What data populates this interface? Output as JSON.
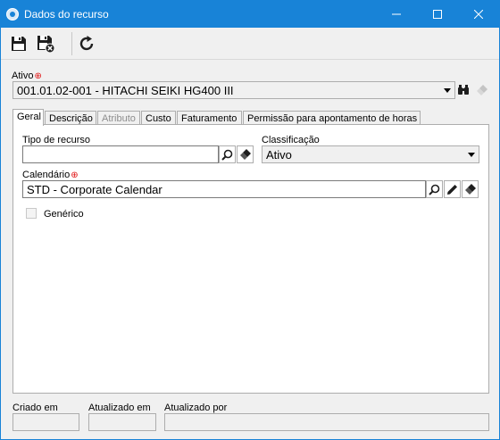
{
  "window": {
    "title": "Dados do recurso",
    "icons": {
      "app": "globe-icon",
      "minimize": "minimize-icon",
      "maximize": "maximize-icon",
      "close": "close-icon"
    }
  },
  "toolbar": {
    "buttons": [
      {
        "name": "save-icon"
      },
      {
        "name": "save-and-close-icon"
      },
      {
        "name": "refresh-icon"
      }
    ]
  },
  "ativo": {
    "label": "Ativo",
    "value": "001.01.02-001 - HITACHI SEIKI HG400 III"
  },
  "tabs": [
    {
      "label": "Geral",
      "active": true,
      "enabled": true
    },
    {
      "label": "Descrição",
      "enabled": true
    },
    {
      "label": "Atributo",
      "enabled": false
    },
    {
      "label": "Custo",
      "enabled": true
    },
    {
      "label": "Faturamento",
      "enabled": true
    },
    {
      "label": "Permissão para apontamento de horas",
      "enabled": true
    }
  ],
  "geral": {
    "tipo_recurso": {
      "label": "Tipo de recurso",
      "value": ""
    },
    "classificacao": {
      "label": "Classificação",
      "value": "Ativo"
    },
    "calendario": {
      "label": "Calendário",
      "value": "STD - Corporate Calendar"
    },
    "generico": {
      "label": "Genérico",
      "checked": false
    }
  },
  "footer": {
    "criado_em": {
      "label": "Criado em",
      "value": ""
    },
    "atualizado_em": {
      "label": "Atualizado em",
      "value": ""
    },
    "atualizado_por": {
      "label": "Atualizado por",
      "value": ""
    }
  },
  "colors": {
    "titlebar": "#1883d7",
    "required": "#e01010"
  }
}
